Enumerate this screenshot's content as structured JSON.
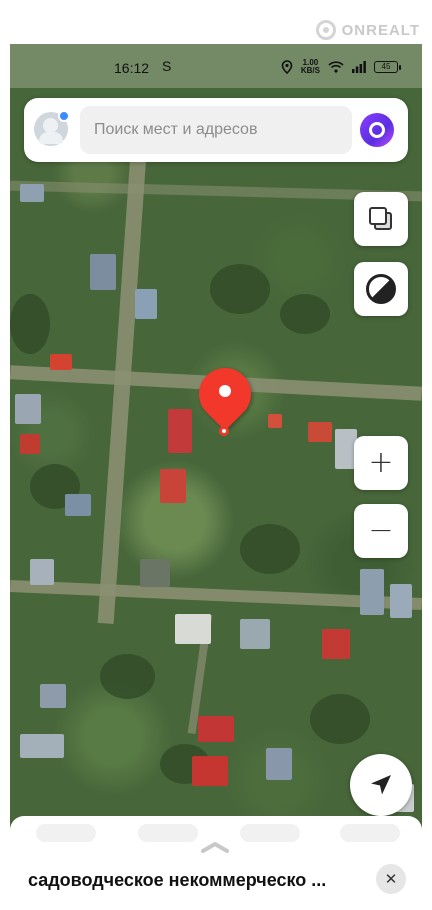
{
  "watermark": {
    "text": "ONREALT"
  },
  "status_bar": {
    "time": "16:12",
    "notification_glyph": "S",
    "speed_value": "1.00",
    "speed_unit": "KB/S",
    "battery": "45"
  },
  "search": {
    "placeholder": "Поиск мест и адресов"
  },
  "controls": {
    "zoom_in_label": "+",
    "zoom_out_label": "−"
  },
  "place_card": {
    "title": "садоводческое некоммерческо ...",
    "close_label": "✕"
  },
  "icons": [
    "profile-icon",
    "alice-voice-icon",
    "layers-icon",
    "map-style-icon",
    "location-pin-icon",
    "navigation-arrow-icon",
    "close-icon",
    "chevron-up-icon"
  ],
  "colors": {
    "pin": "#f2382a",
    "alice": "#7a35f0",
    "profile_badge": "#3b8cff"
  }
}
